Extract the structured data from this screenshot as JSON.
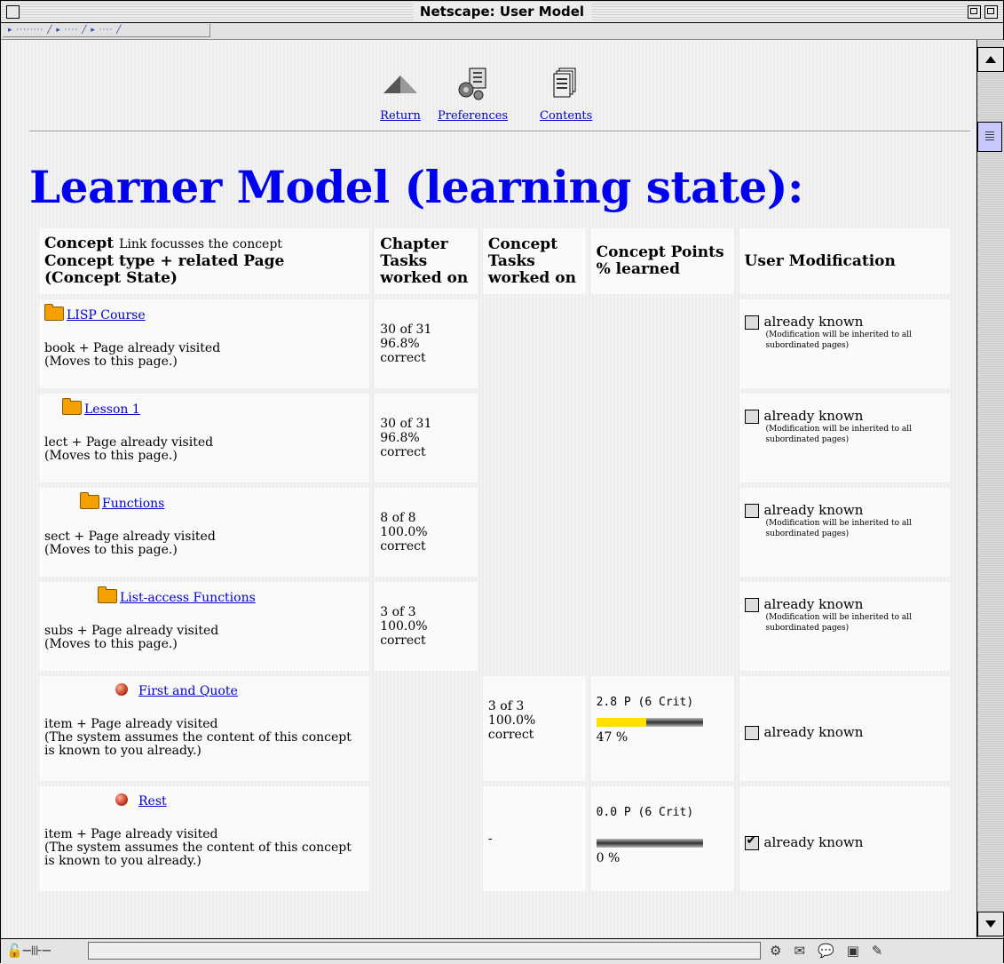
{
  "window": {
    "title": "Netscape: User Model"
  },
  "toolbar": {
    "return_label": "Return",
    "preferences_label": "Preferences",
    "contents_label": "Contents"
  },
  "page": {
    "heading": "Learner Model (learning state):"
  },
  "table": {
    "headers": {
      "concept_main": "Concept",
      "concept_sub": "Link focusses the concept",
      "concept_line2": "Concept type + related Page",
      "concept_line3": "(Concept State)",
      "chapter_tasks": "Chapter Tasks worked on",
      "concept_tasks": "Concept Tasks worked on",
      "concept_points": "Concept Points % learned",
      "user_mod": "User Modification"
    },
    "rows": [
      {
        "name": "LISP Course",
        "type_line": "book + Page already visited",
        "state": "(Moves to this page.)",
        "chapter": [
          "30 of 31",
          "96.8%",
          "correct"
        ],
        "modify": "already known",
        "note": "(Modification will be inherited to all subordinated pages)",
        "checked": false
      },
      {
        "name": "Lesson 1",
        "type_line": "lect + Page already visited",
        "state": "(Moves to this page.)",
        "chapter": [
          "30 of 31",
          "96.8%",
          "correct"
        ],
        "modify": "already known",
        "note": "(Modification will be inherited to all subordinated pages)",
        "checked": false
      },
      {
        "name": "Functions",
        "type_line": "sect + Page already visited",
        "state": "(Moves to this page.)",
        "chapter": [
          "8 of 8",
          "100.0%",
          "correct"
        ],
        "modify": "already known",
        "note": "(Modification will be inherited to all subordinated pages)",
        "checked": false
      },
      {
        "name": "List-access Functions",
        "type_line": "subs + Page already visited",
        "state": "(Moves to this page.)",
        "chapter": [
          "3 of 3",
          "100.0%",
          "correct"
        ],
        "modify": "already known",
        "note": "(Modification will be inherited to all subordinated pages)",
        "checked": false
      },
      {
        "name": "First and Quote",
        "type_line": "item + Page already visited",
        "state": "(The system assumes the content of this concept is known to you already.)",
        "concept_tasks": [
          "3 of 3",
          "100.0%",
          "correct"
        ],
        "points": "2.8 P (6 Crit)",
        "learned_pct": "47 %",
        "learned_fraction": 0.47,
        "modify": "already known",
        "checked": false
      },
      {
        "name": "Rest",
        "type_line": "item + Page already visited",
        "state": "(The system assumes the content of this concept is known to you already.)",
        "concept_tasks_dash": "-",
        "points": "0.0 P (6 Crit)",
        "learned_pct": "0 %",
        "learned_fraction": 0.0,
        "modify": "already known",
        "checked": true
      }
    ]
  }
}
